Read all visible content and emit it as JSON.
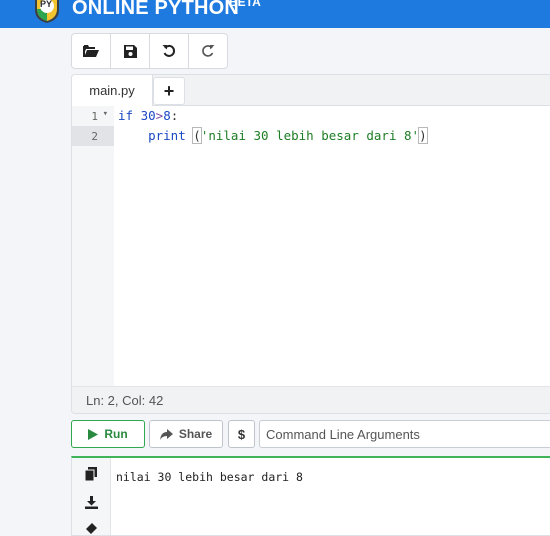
{
  "header": {
    "brand": "ONLINE PYTHON",
    "badge": "BETA",
    "logo_text": "PY",
    "bg_color": "#1f7ae0"
  },
  "toolbar": {
    "buttons": [
      {
        "name": "open-folder-icon"
      },
      {
        "name": "save-icon"
      },
      {
        "name": "undo-icon"
      },
      {
        "name": "redo-icon"
      }
    ]
  },
  "editor": {
    "tab_label": "main.py",
    "add_tab_label": "+",
    "line_numbers": [
      "1",
      "2"
    ],
    "fold_marker": "▾",
    "lines": {
      "l1": {
        "kw": "if",
        "sp1": " ",
        "n1": "30",
        "op": ">",
        "n2": "8",
        "colon": ":"
      },
      "l2": {
        "indent": "    ",
        "fn": "print",
        "sp": " ",
        "open": "(",
        "str": "'nilai 30 lebih besar dari 8'",
        "close": ")"
      }
    },
    "status": "Ln: 2,  Col: 42"
  },
  "run_bar": {
    "run_label": "Run",
    "share_label": "Share",
    "dollar_label": "$",
    "args_placeholder": "Command Line Arguments",
    "accent_green": "#2fa84f"
  },
  "output": {
    "text": "nilai 30 lebih besar dari 8",
    "side_icons": [
      "copy-icon",
      "download-icon",
      "eraser-icon"
    ]
  }
}
